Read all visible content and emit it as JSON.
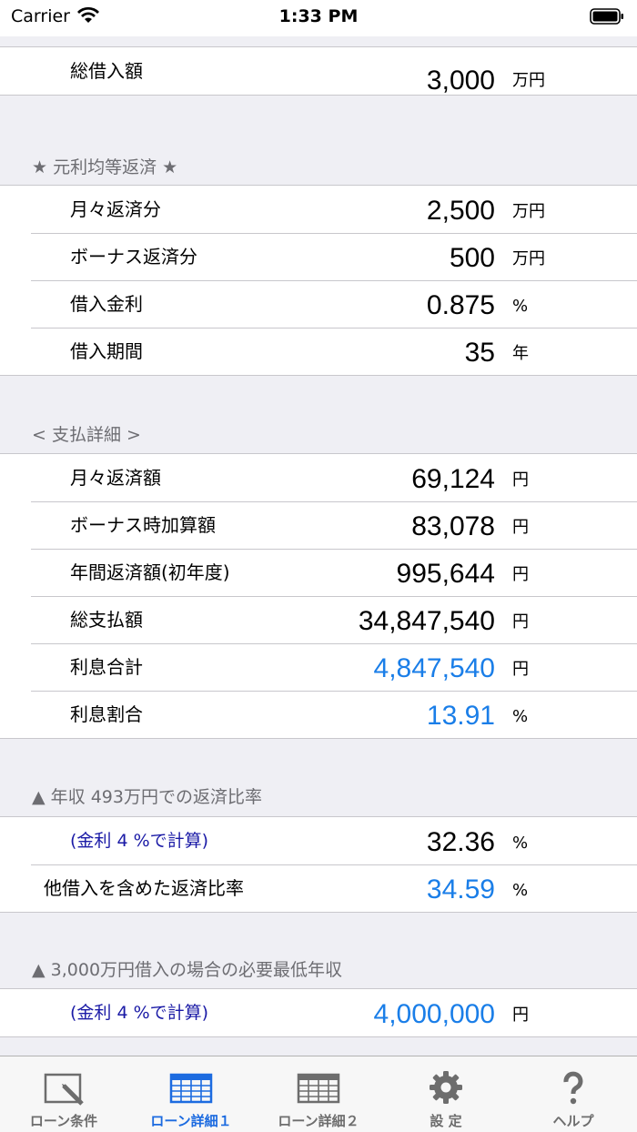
{
  "status_bar": {
    "carrier": "Carrier",
    "time": "1:33 PM"
  },
  "total": {
    "label": "総借入額",
    "value": "3,000",
    "unit": "万円"
  },
  "equal_section": {
    "header": "★ 元利均等返済 ★",
    "rows": [
      {
        "label": "月々返済分",
        "value": "2,500",
        "unit": "万円"
      },
      {
        "label": "ボーナス返済分",
        "value": "500",
        "unit": "万円"
      },
      {
        "label": "借入金利",
        "value": "0.875",
        "unit": "%"
      },
      {
        "label": "借入期間",
        "value": "35",
        "unit": "年"
      }
    ]
  },
  "detail_section": {
    "header": "< 支払詳細 >",
    "rows": [
      {
        "label": "月々返済額",
        "value": "69,124",
        "unit": "円"
      },
      {
        "label": "ボーナス時加算額",
        "value": "83,078",
        "unit": "円"
      },
      {
        "label": "年間返済額(初年度)",
        "value": "995,644",
        "unit": "円"
      },
      {
        "label": "総支払額",
        "value": "34,847,540",
        "unit": "円"
      },
      {
        "label": "利息合計",
        "value": "4,847,540",
        "unit": "円"
      },
      {
        "label": "利息割合",
        "value": "13.91",
        "unit": "%"
      }
    ]
  },
  "ratio_section": {
    "header": "▲ 年収 493万円での返済比率",
    "rows": [
      {
        "label": "(金利 4 %で計算)",
        "value": "32.36",
        "unit": "%"
      },
      {
        "label": "他借入を含めた返済比率",
        "value": "34.59",
        "unit": "%"
      }
    ]
  },
  "income_section": {
    "header": "▲ 3,000万円借入の場合の必要最低年収",
    "rows": [
      {
        "label": "(金利 4 %で計算)",
        "value": "4,000,000",
        "unit": "円"
      }
    ]
  },
  "tabs": [
    {
      "label": "ローン条件",
      "icon": "edit-icon"
    },
    {
      "label": "ローン詳細１",
      "icon": "table-icon"
    },
    {
      "label": "ローン詳細２",
      "icon": "table-icon"
    },
    {
      "label": "設  定",
      "icon": "gear-icon"
    },
    {
      "label": "ヘルプ",
      "icon": "question-icon"
    }
  ],
  "colors": {
    "blue_value": "#1a7ee8",
    "blue_label": "#1a1aa6",
    "active_tab": "#1c6be0"
  }
}
